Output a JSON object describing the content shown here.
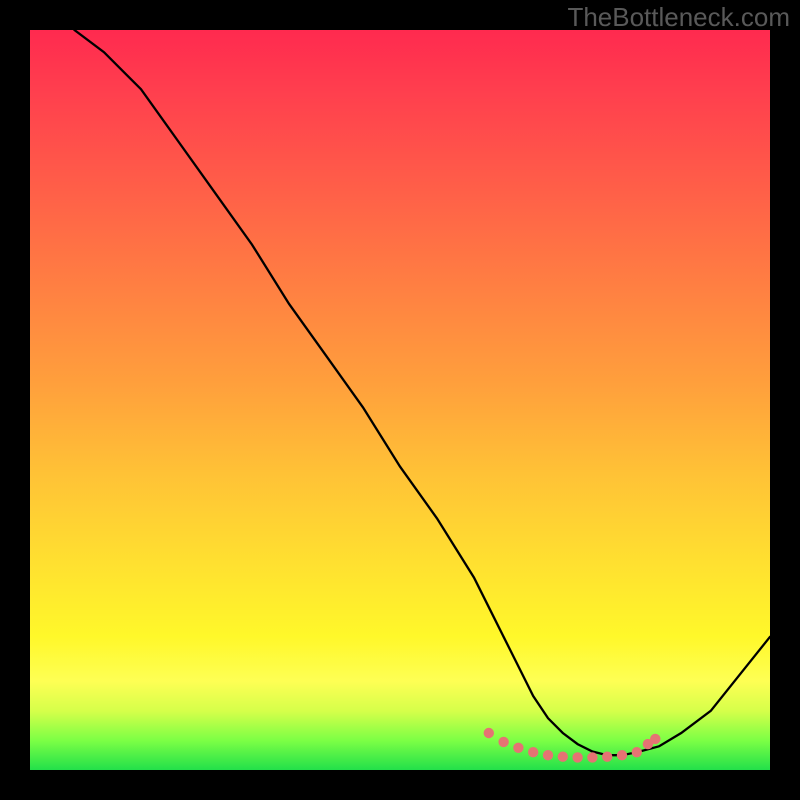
{
  "watermark": "TheBottleneck.com",
  "chart_data": {
    "type": "line",
    "title": "",
    "xlabel": "",
    "ylabel": "",
    "xlim": [
      0,
      100
    ],
    "ylim": [
      0,
      100
    ],
    "grid": false,
    "series": [
      {
        "name": "bottleneck-curve",
        "x": [
          6,
          10,
          15,
          20,
          25,
          30,
          35,
          40,
          45,
          50,
          55,
          60,
          62,
          64,
          66,
          68,
          70,
          72,
          74,
          76,
          78,
          80,
          82,
          85,
          88,
          92,
          96,
          100
        ],
        "y": [
          100,
          97,
          92,
          85,
          78,
          71,
          63,
          56,
          49,
          41,
          34,
          26,
          22,
          18,
          14,
          10,
          7,
          5,
          3.5,
          2.5,
          2,
          2,
          2.4,
          3.2,
          5,
          8,
          13,
          18
        ]
      }
    ],
    "markers": {
      "name": "optimal-range-dots",
      "color": "#e57373",
      "points": [
        {
          "x": 62,
          "y": 5
        },
        {
          "x": 64,
          "y": 3.8
        },
        {
          "x": 66,
          "y": 3
        },
        {
          "x": 68,
          "y": 2.4
        },
        {
          "x": 70,
          "y": 2
        },
        {
          "x": 72,
          "y": 1.8
        },
        {
          "x": 74,
          "y": 1.7
        },
        {
          "x": 76,
          "y": 1.7
        },
        {
          "x": 78,
          "y": 1.8
        },
        {
          "x": 80,
          "y": 2
        },
        {
          "x": 82,
          "y": 2.4
        },
        {
          "x": 83.5,
          "y": 3.5
        },
        {
          "x": 84.5,
          "y": 4.2
        }
      ]
    },
    "colors": {
      "gradient_top": "#ff2a4f",
      "gradient_mid": "#ffd834",
      "gradient_bottom": "#22e04a",
      "curve": "#000000",
      "marker": "#e57373"
    }
  }
}
